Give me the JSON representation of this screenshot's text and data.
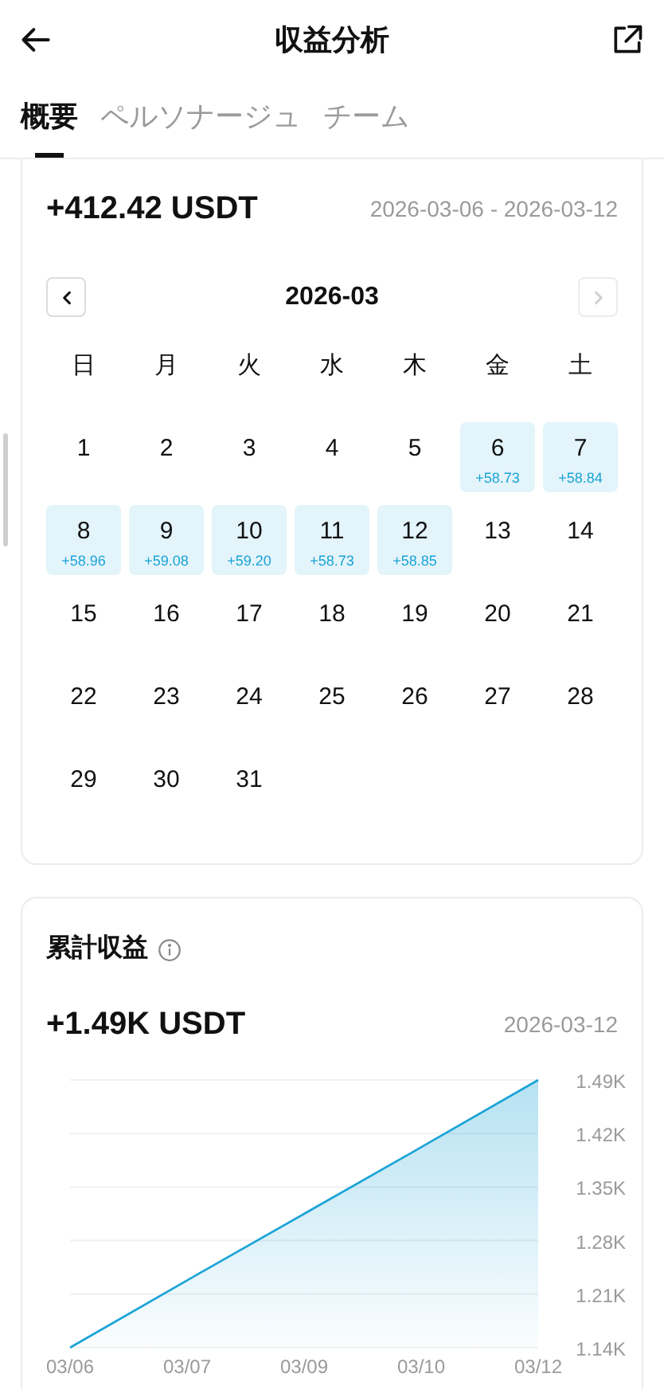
{
  "header": {
    "title": "収益分析"
  },
  "tabs": [
    {
      "label": "概要",
      "selected": true
    },
    {
      "label": "ペルソナージュ",
      "selected": false
    },
    {
      "label": "チーム",
      "selected": false
    }
  ],
  "summary": {
    "amount": "+412.42 USDT",
    "range": "2026-03-06 - 2026-03-12"
  },
  "calendar": {
    "month": "2026-03",
    "prev_disabled": false,
    "next_disabled": true,
    "weekdays": [
      "日",
      "月",
      "火",
      "水",
      "木",
      "金",
      "土"
    ],
    "days": [
      {
        "day": "1"
      },
      {
        "day": "2"
      },
      {
        "day": "3"
      },
      {
        "day": "4"
      },
      {
        "day": "5"
      },
      {
        "day": "6",
        "earning": "+58.73"
      },
      {
        "day": "7",
        "earning": "+58.84"
      },
      {
        "day": "8",
        "earning": "+58.96"
      },
      {
        "day": "9",
        "earning": "+59.08"
      },
      {
        "day": "10",
        "earning": "+59.20"
      },
      {
        "day": "11",
        "earning": "+58.73"
      },
      {
        "day": "12",
        "earning": "+58.85"
      },
      {
        "day": "13"
      },
      {
        "day": "14"
      },
      {
        "day": "15"
      },
      {
        "day": "16"
      },
      {
        "day": "17"
      },
      {
        "day": "18"
      },
      {
        "day": "19"
      },
      {
        "day": "20"
      },
      {
        "day": "21"
      },
      {
        "day": "22"
      },
      {
        "day": "23"
      },
      {
        "day": "24"
      },
      {
        "day": "25"
      },
      {
        "day": "26"
      },
      {
        "day": "27"
      },
      {
        "day": "28"
      },
      {
        "day": "29"
      },
      {
        "day": "30"
      },
      {
        "day": "31"
      }
    ]
  },
  "cumulative": {
    "title": "累計収益",
    "amount": "+1.49K USDT",
    "date": "2026-03-12",
    "chart_data": {
      "type": "area",
      "categories": [
        "03/06",
        "03/07",
        "03/09",
        "03/10",
        "03/12"
      ],
      "series": [
        {
          "color": "#1aa3d6",
          "values": [
            1140,
            1228,
            1315,
            1402,
            1490
          ]
        }
      ],
      "grid": true,
      "ylim": [
        1140,
        1490
      ],
      "yticks": [
        {
          "value": 1140,
          "label": "1.14K"
        },
        {
          "value": 1210,
          "label": "1.21K"
        },
        {
          "value": 1280,
          "label": "1.28K"
        },
        {
          "value": 1350,
          "label": "1.35K"
        },
        {
          "value": 1420,
          "label": "1.42K"
        },
        {
          "value": 1490,
          "label": "1.49K"
        }
      ]
    }
  }
}
